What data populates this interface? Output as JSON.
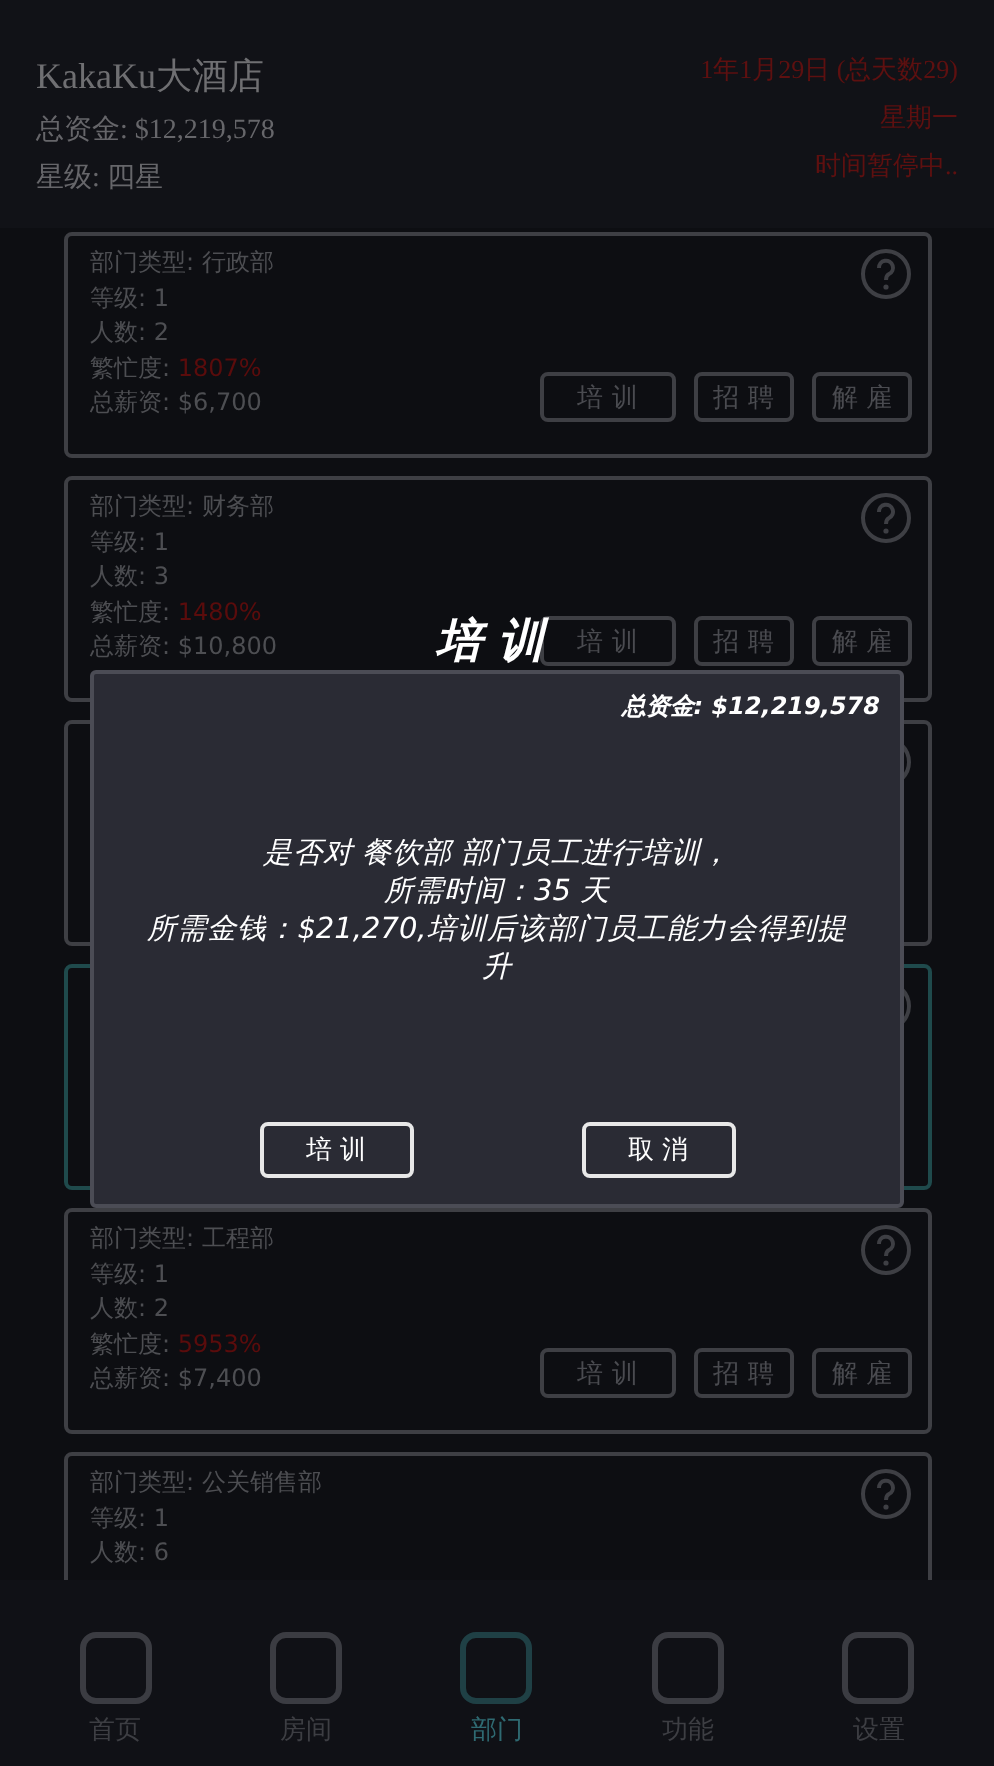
{
  "header": {
    "hotel_name": "KakaKu大酒店",
    "funds": "总资金: $12,219,578",
    "stars": "星级: 四星",
    "date": "1年1月29日 (总天数29)",
    "weekday": "星期一",
    "time_status": "时间暂停中.."
  },
  "departments": [
    {
      "selected": false,
      "type": "部门类型: 行政部",
      "level": "等级: 1",
      "count": "人数: 2",
      "busy_label": "繁忙度: ",
      "busy": "1807%",
      "salary": "总薪资: $6,700",
      "buttons": [
        "培 训",
        "招 聘",
        "解 雇"
      ]
    },
    {
      "selected": false,
      "type": "部门类型: 财务部",
      "level": "等级: 1",
      "count": "人数: 3",
      "busy_label": "繁忙度: ",
      "busy": "1480%",
      "salary": "总薪资: $10,800",
      "buttons": [
        "培 训",
        "招 聘",
        "解 雇"
      ]
    },
    {
      "selected": false
    },
    {
      "selected": true
    },
    {
      "selected": false,
      "type": "部门类型: 工程部",
      "level": "等级: 1",
      "count": "人数: 2",
      "busy_label": "繁忙度: ",
      "busy": "5953%",
      "salary": "总薪资: $7,400",
      "buttons": [
        "培 训",
        "招 聘",
        "解 雇"
      ]
    },
    {
      "selected": false,
      "type": "部门类型: 公关销售部",
      "level": "等级: 1",
      "count": "人数: 6"
    }
  ],
  "dialog": {
    "title": "培 训",
    "funds": "总资金: $12,219,578",
    "message": [
      "是否对 餐饮部 部门员工进行培训，",
      "所需时间：35 天",
      "所需金钱：$21,270,培训后该部门员工能力会得到提升"
    ],
    "buttons": [
      "培 训",
      "取 消"
    ]
  },
  "nav": [
    {
      "label": "首页",
      "selected": false
    },
    {
      "label": "房间",
      "selected": false
    },
    {
      "label": "部门",
      "selected": true
    },
    {
      "label": "功能",
      "selected": false
    },
    {
      "label": "设置",
      "selected": false
    }
  ]
}
